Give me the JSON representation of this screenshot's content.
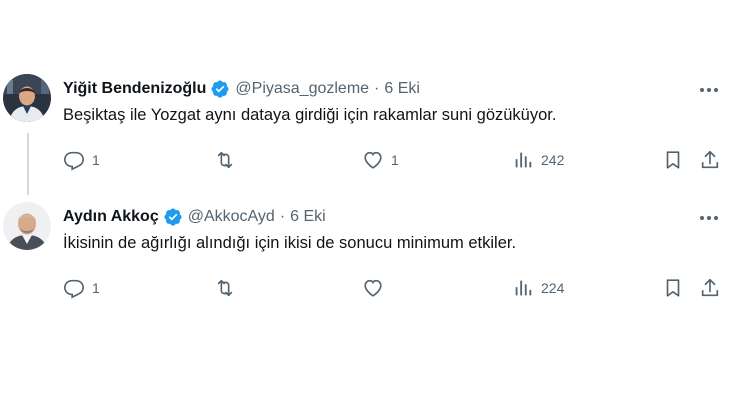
{
  "tweets": [
    {
      "name": "Yiğit Bendenizoğlu",
      "handle": "@Piyasa_gozleme",
      "separator": "·",
      "date": "6 Eki",
      "text": "Beşiktaş ile Yozgat aynı dataya girdiği için rakamlar suni gözüküyor.",
      "replies": "1",
      "retweets": "",
      "likes": "1",
      "views": "242"
    },
    {
      "name": "Aydın Akkoç",
      "handle": "@AkkocAyd",
      "separator": "·",
      "date": "6 Eki",
      "text": "İkisinin de ağırlığı alındığı için ikisi de sonucu minimum etkiler.",
      "replies": "1",
      "retweets": "",
      "likes": "",
      "views": "224"
    }
  ],
  "icons": {
    "verified": "verified-badge-icon",
    "more": "more-icon",
    "reply": "reply-icon",
    "retweet": "retweet-icon",
    "like": "heart-icon",
    "views": "views-icon",
    "bookmark": "bookmark-icon",
    "share": "share-icon"
  },
  "colors": {
    "verified": "#1d9bf0",
    "secondary_text": "#536471",
    "thread_line": "#cfd9de"
  }
}
